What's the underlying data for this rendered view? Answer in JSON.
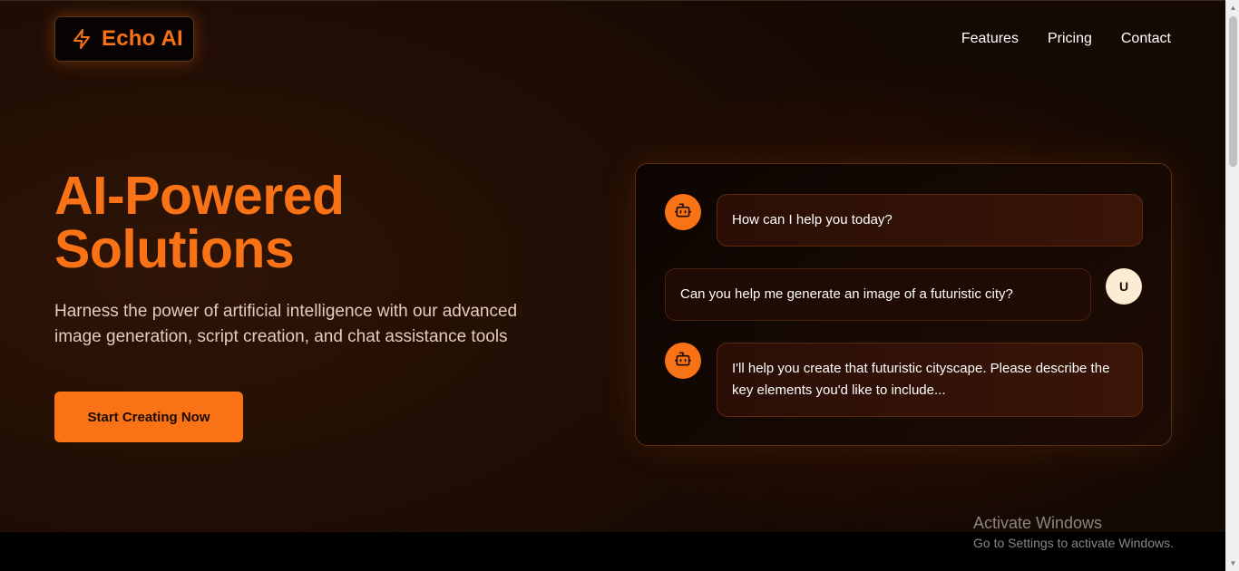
{
  "header": {
    "logo_text": "Echo AI",
    "nav": [
      "Features",
      "Pricing",
      "Contact"
    ]
  },
  "hero": {
    "title_line1": "AI-Powered",
    "title_line2": "Solutions",
    "subtitle": "Harness the power of artificial intelligence with our advanced image generation, script creation, and chat assistance tools",
    "cta_label": "Start Creating Now"
  },
  "chat": {
    "messages": [
      {
        "role": "bot",
        "text": "How can I help you today?"
      },
      {
        "role": "user",
        "avatar": "U",
        "text": "Can you help me generate an image of a futuristic city?"
      },
      {
        "role": "bot",
        "text": "I'll help you create that futuristic cityscape. Please describe the key elements you'd like to include..."
      }
    ]
  },
  "watermark": {
    "title": "Activate Windows",
    "subtitle": "Go to Settings to activate Windows."
  },
  "icons": {
    "logo": "lightning-bolt-icon",
    "bot": "robot-icon"
  },
  "colors": {
    "accent": "#f97316",
    "background": "#1f0d04"
  }
}
